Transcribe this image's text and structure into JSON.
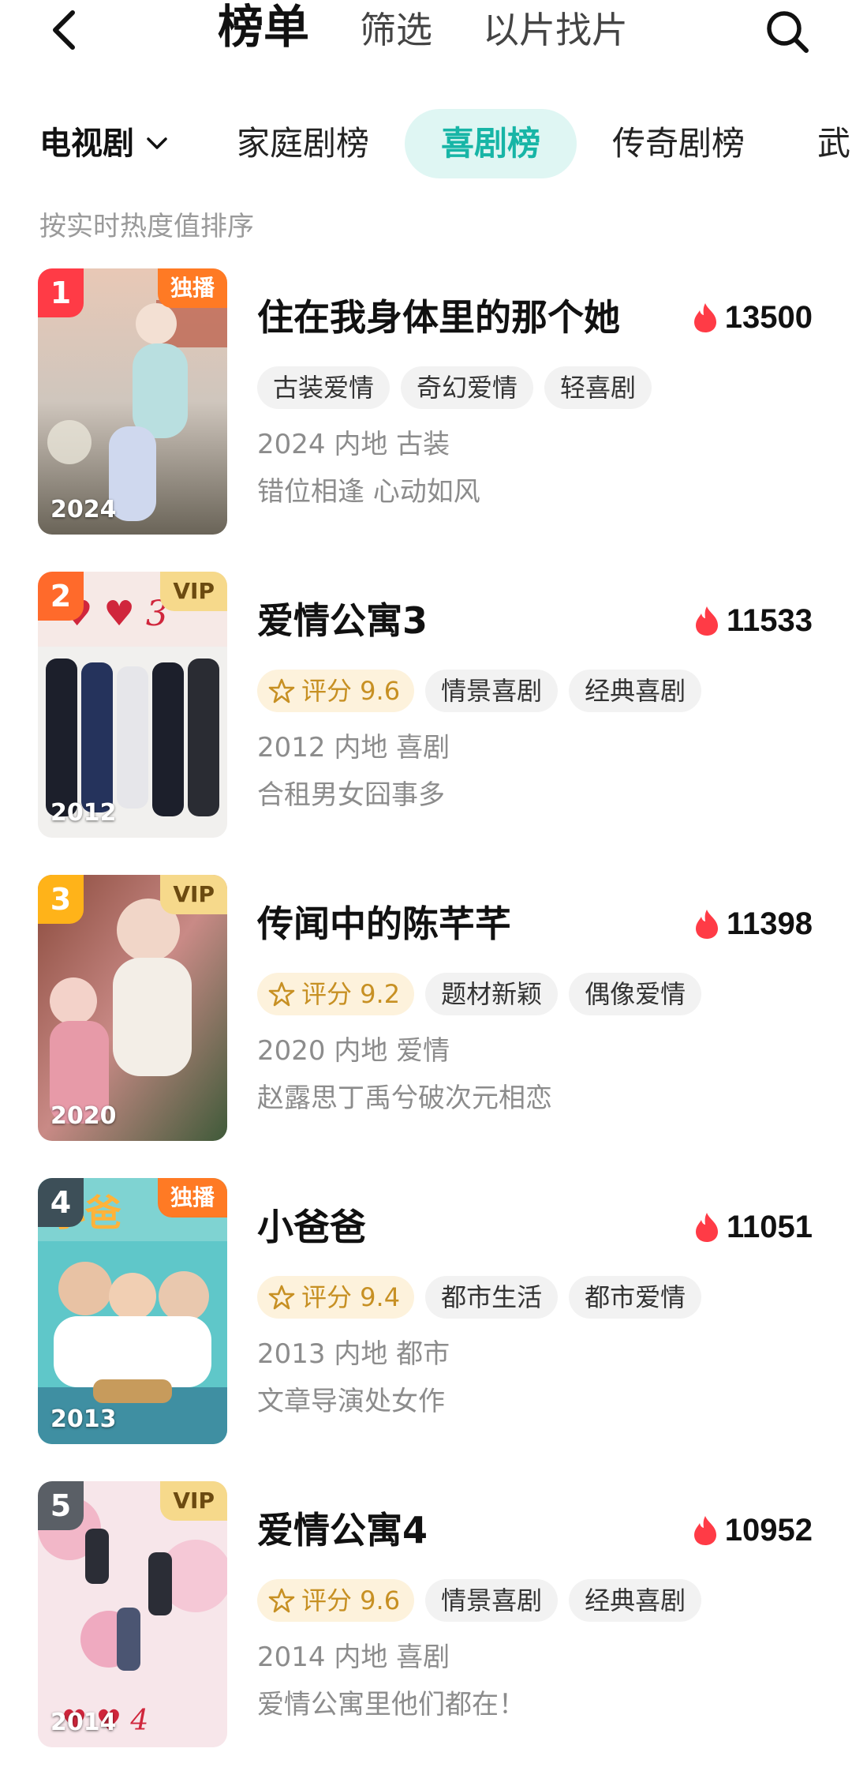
{
  "header": {
    "back_icon": "chevron-left-icon",
    "tabs": [
      {
        "label": "榜单",
        "active": true
      },
      {
        "label": "筛选",
        "active": false
      },
      {
        "label": "以片找片",
        "active": false
      }
    ],
    "search_icon": "search-icon"
  },
  "categories": {
    "dropdown_label": "电视剧",
    "items": [
      "家庭剧榜",
      "喜剧榜",
      "传奇剧榜",
      "武"
    ],
    "selected": "喜剧榜",
    "accent_color": "#17b5a6"
  },
  "sort_hint": "按实时热度值排序",
  "items": [
    {
      "rank": "1",
      "rank_color": "#ff3b46",
      "badge": "独播",
      "badge_type": "excl",
      "poster_year": "2024",
      "title": "住在我身体里的那个她",
      "heat": "13500",
      "score": null,
      "tags": [
        "古装爱情",
        "奇幻爱情",
        "轻喜剧"
      ],
      "meta": "2024 内地 古装",
      "desc": "错位相逢 心动如风"
    },
    {
      "rank": "2",
      "rank_color": "#ff6a2b",
      "badge": "VIP",
      "badge_type": "vip",
      "poster_year": "2012",
      "title": "爱情公寓3",
      "heat": "11533",
      "score": "评分 9.6",
      "tags": [
        "情景喜剧",
        "经典喜剧"
      ],
      "meta": "2012 内地 喜剧",
      "desc": "合租男女囧事多"
    },
    {
      "rank": "3",
      "rank_color": "#ffb319",
      "badge": "VIP",
      "badge_type": "vip",
      "poster_year": "2020",
      "title": "传闻中的陈芊芊",
      "heat": "11398",
      "score": "评分 9.2",
      "tags": [
        "题材新颖",
        "偶像爱情"
      ],
      "meta": "2020 内地 爱情",
      "desc": "赵露思丁禹兮破次元相恋"
    },
    {
      "rank": "4",
      "rank_color": "#3d4f58",
      "badge": "独播",
      "badge_type": "excl",
      "poster_year": "2013",
      "title": "小爸爸",
      "heat": "11051",
      "score": "评分 9.4",
      "tags": [
        "都市生活",
        "都市爱情"
      ],
      "meta": "2013 内地 都市",
      "desc": "文章导演处女作"
    },
    {
      "rank": "5",
      "rank_color": "#5a5f66",
      "badge": "VIP",
      "badge_type": "vip",
      "poster_year": "2014",
      "title": "爱情公寓4",
      "heat": "10952",
      "score": "评分 9.6",
      "tags": [
        "情景喜剧",
        "经典喜剧"
      ],
      "meta": "2014 内地 喜剧",
      "desc": "爱情公寓里他们都在！"
    }
  ]
}
